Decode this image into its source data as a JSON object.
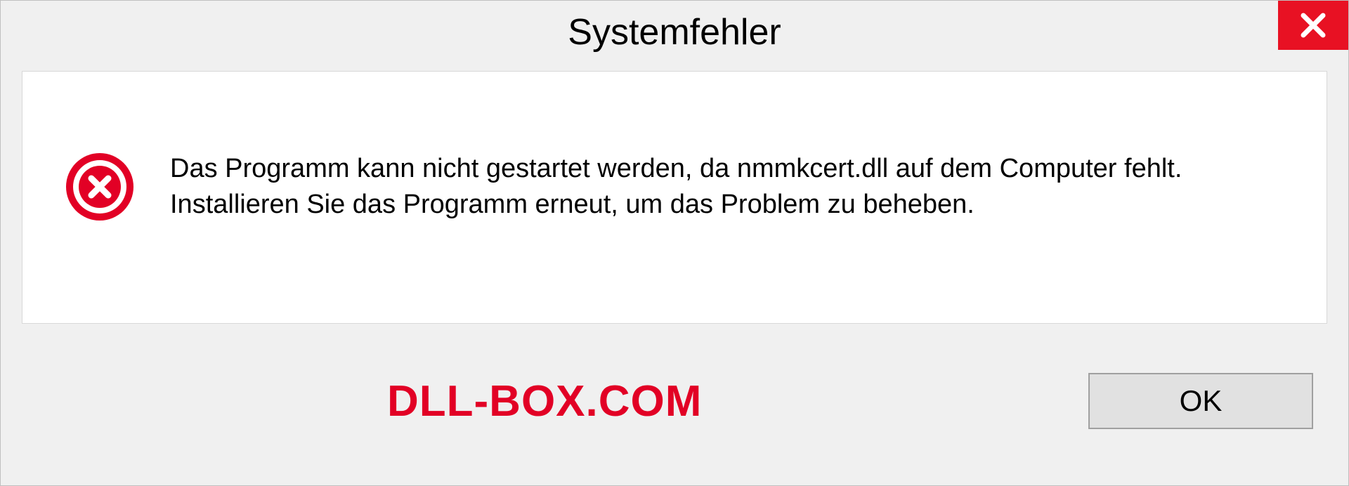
{
  "dialog": {
    "title": "Systemfehler",
    "message": "Das Programm kann nicht gestartet werden, da nmmkcert.dll auf dem Computer fehlt. Installieren Sie das Programm erneut, um das Problem zu beheben.",
    "ok_label": "OK"
  },
  "watermark": {
    "text": "DLL-BOX.COM"
  }
}
